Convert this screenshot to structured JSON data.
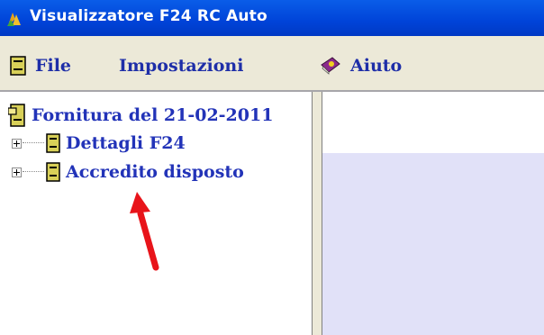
{
  "window": {
    "title": "Visualizzatore F24 RC Auto",
    "title_bar_color": "#0055e5"
  },
  "menu": [
    {
      "label": "File",
      "icon": "cabinet-icon"
    },
    {
      "label": "Impostazioni"
    },
    {
      "label": "Aiuto",
      "icon": "help-book-icon"
    }
  ],
  "tree": {
    "root": {
      "label": "Fornitura del 21-02-2011",
      "icon": "cabinet-open-icon"
    },
    "children": [
      {
        "label": "Dettagli F24",
        "icon": "cabinet-icon",
        "expander": "+"
      },
      {
        "label": "Accredito disposto",
        "icon": "cabinet-icon",
        "expander": "+"
      }
    ]
  },
  "annotation": {
    "shape": "red-arrow",
    "color": "#e8141a",
    "points_to": "Accredito disposto"
  },
  "colors": {
    "link_text": "#2233b8",
    "menubar_bg": "#ece9d8",
    "right_pane_band": "#e1e1f8"
  }
}
